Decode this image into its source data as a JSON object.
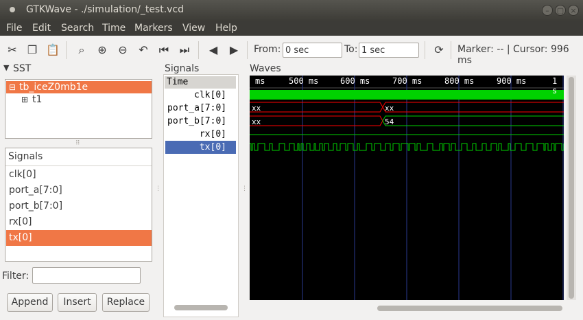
{
  "window": {
    "title": "GTKWave - ./simulation/_test.vcd"
  },
  "menu": [
    "File",
    "Edit",
    "Search",
    "Time",
    "Markers",
    "View",
    "Help"
  ],
  "toolbar": {
    "from_label": "From:",
    "from_value": "0 sec",
    "to_label": "To:",
    "to_value": "1 sec",
    "marker_text": "Marker: -- | Cursor: 996 ms"
  },
  "sst": {
    "label": "SST",
    "tree": [
      {
        "label": "tb_iceZ0mb1e",
        "selected": true
      },
      {
        "label": "t1",
        "selected": false
      }
    ],
    "signals_header": "Signals",
    "signals": [
      "clk[0]",
      "port_a[7:0]",
      "port_b[7:0]",
      "rx[0]",
      "tx[0]"
    ],
    "selected_signal": "tx[0]",
    "filter_label": "Filter:",
    "filter_value": "",
    "buttons": {
      "append": "Append",
      "insert": "Insert",
      "replace": "Replace"
    }
  },
  "signals_pane": {
    "label": "Signals",
    "time_header": "Time",
    "rows": [
      "clk[0]",
      "port_a[7:0]",
      "port_b[7:0]",
      "rx[0]",
      "tx[0]"
    ],
    "selected_row": "tx[0]"
  },
  "waves_pane": {
    "label": "Waves",
    "ticks": [
      "ms",
      "500 ms",
      "600 ms",
      "700 ms",
      "800 ms",
      "900 ms",
      "1 s"
    ],
    "port_a_values": [
      "xx",
      "xx"
    ],
    "port_b_values": [
      "xx",
      "54"
    ]
  },
  "colors": {
    "selection": "#f07746",
    "selected_signal": "#4a6bb4",
    "wave_green": "#00d200",
    "wave_red": "#ff0000",
    "wave_bg": "#000000"
  }
}
